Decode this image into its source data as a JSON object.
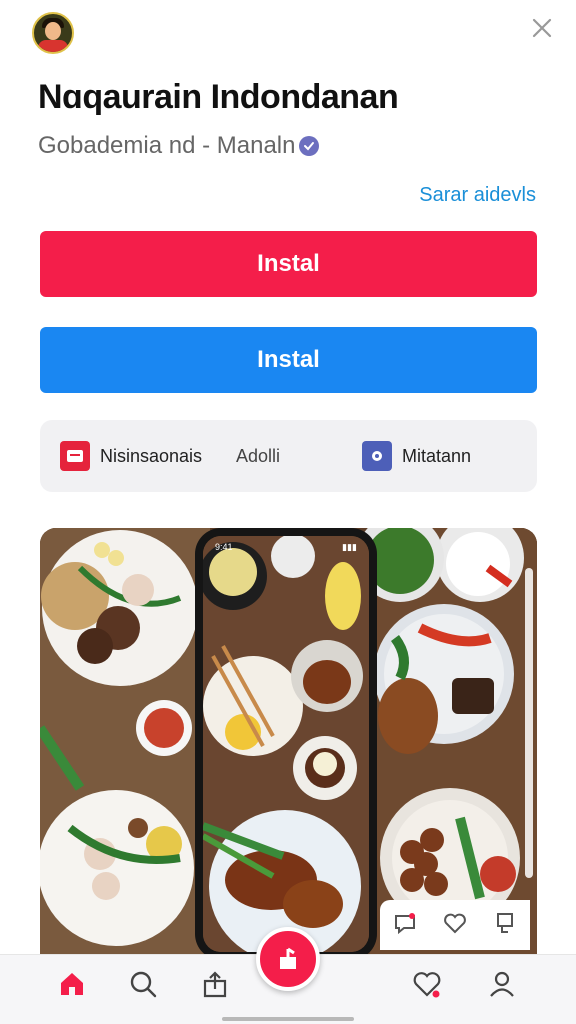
{
  "header": {
    "avatar_icon": "user-avatar-icon",
    "close_icon": "close-icon",
    "title": "Nɑqaurain Indondanan",
    "subtitle": "Gobademia nd - Manaln",
    "verified_icon": "verified-badge-icon",
    "link": "Sarar aidevls"
  },
  "buttons": {
    "install_primary": "Instal",
    "install_secondary": "Instal"
  },
  "infobar": {
    "item1_icon": "message-icon",
    "item1_label": "Nisinsaonais",
    "item2_label": "Adolli",
    "item3_icon": "gear-badge-icon",
    "item3_label": "Mitatann"
  },
  "gallery": {
    "phone_time": "9:41",
    "actions": [
      "comment-icon",
      "heart-icon",
      "bookmark-icon"
    ]
  },
  "bottom_nav": {
    "items": [
      "home-icon",
      "search-icon",
      "share-icon",
      "add-post-icon",
      "activity-heart-icon",
      "profile-icon"
    ]
  },
  "colors": {
    "accent_red": "#f41e4a",
    "accent_blue": "#1a87f2",
    "link_blue": "#1a8fd8"
  }
}
